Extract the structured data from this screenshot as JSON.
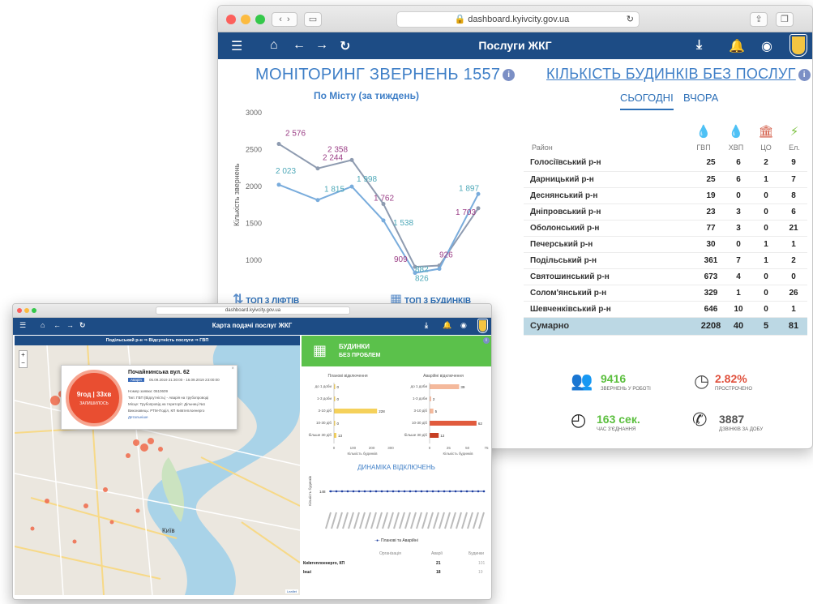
{
  "back": {
    "url": "dashboard.kyivcity.gov.ua",
    "app_title": "Послуги ЖКГ",
    "monitoring": {
      "title": "МОНІТОРИНГ ЗВЕРНЕНЬ 1557",
      "subtitle": "По Місту (за тиждень)",
      "ylabel": "Кількість звернень",
      "yticks": [
        "3000",
        "2500",
        "2000",
        "1500",
        "1000"
      ]
    },
    "buildings": {
      "title": "КІЛЬКІСТЬ БУДИНКІВ БЕЗ ПОСЛУГ",
      "tab_today": "СЬОГОДНІ",
      "tab_yesterday": "ВЧОРА",
      "col_district": "Район",
      "cols": [
        "ГВП",
        "ХВП",
        "ЦО",
        "Ел."
      ],
      "rows": [
        {
          "name": "Голосіївський р-н",
          "v": [
            "25",
            "6",
            "2",
            "9"
          ]
        },
        {
          "name": "Дарницький р-н",
          "v": [
            "25",
            "6",
            "1",
            "7"
          ]
        },
        {
          "name": "Деснянський р-н",
          "v": [
            "19",
            "0",
            "0",
            "8"
          ]
        },
        {
          "name": "Дніпровський р-н",
          "v": [
            "23",
            "3",
            "0",
            "6"
          ]
        },
        {
          "name": "Оболонський р-н",
          "v": [
            "77",
            "3",
            "0",
            "21"
          ]
        },
        {
          "name": "Печерський р-н",
          "v": [
            "30",
            "0",
            "1",
            "1"
          ]
        },
        {
          "name": "Подільський р-н",
          "v": [
            "361",
            "7",
            "1",
            "2"
          ]
        },
        {
          "name": "Святошинський р-н",
          "v": [
            "673",
            "4",
            "0",
            "0"
          ]
        },
        {
          "name": "Солом'янський р-н",
          "v": [
            "329",
            "1",
            "0",
            "26"
          ]
        },
        {
          "name": "Шевченківський р-н",
          "v": [
            "646",
            "10",
            "0",
            "1"
          ]
        }
      ],
      "total": {
        "name": "Сумарно",
        "v": [
          "2208",
          "40",
          "5",
          "81"
        ]
      }
    },
    "top_lifts": "ТОП 3 ЛІФТІВ",
    "top_buildings": "ТОП 3 БУДИНКІВ",
    "stats": {
      "in_work_value": "9416",
      "in_work_label": "ЗВЕРНЕНЬ У РОБОТІ",
      "overdue_value": "2.82%",
      "overdue_label": "ПРОСТРОЧЕНО",
      "connect_value": "163 сек.",
      "connect_label": "ЧАС З'ЄДНАННЯ",
      "calls_value": "3887",
      "calls_label": "ДЗВІНКІВ ЗА ДОБУ"
    }
  },
  "front": {
    "url": "dashboard.kyivcity.gov.ua",
    "app_title": "Карта подачі послуг ЖКГ",
    "breadcrumb": "Подільський р-н ⇒ Відсутність послуги ⇒ ГВП",
    "popup": {
      "address": "Почайнинська вул. 62",
      "badge": "Аварія",
      "period": "05.09.2019 21:30:00 - 16.09.2019 23:00:00",
      "order": "Номер заявки: 0610609",
      "type": "Тип: ГВП (Відсутність) - Аварія на трубопроводі",
      "place": "Місце: Трубопровід на території: Дільниці №1",
      "executor": "Виконавець: РТМ-Поділ, КП Київтеплоенерго",
      "details": "Детальніше",
      "timer": "9год | 33хв",
      "timer_label": "ЗАЛИШИЛОСЬ"
    },
    "city_label": "Київ",
    "leaflet": "Leaflet",
    "no_problems": "БУДИНКИ",
    "no_problems2": "БЕЗ ПРОБЛЕМ",
    "planned_title": "Планові відключення",
    "emergency_title": "Аварійні відключення",
    "dyn_title": "ДИНАМІКА ВІДКЛЮЧЕНЬ",
    "dyn_legend": "Планові та Аварійні",
    "dyn_value": "148",
    "x_caption": "Кількість будинків",
    "y_caption": "Кількість будинків",
    "table_head": [
      "Організація",
      "Аварії",
      "Будинки"
    ],
    "table_rows": [
      {
        "org": "Київтеплоенерго, КП",
        "a": "21",
        "b": "101"
      },
      {
        "org": "Інші",
        "a": "18",
        "b": "19"
      }
    ]
  },
  "chart_data": [
    {
      "type": "line",
      "title": "МОНІТОРИНГ ЗВЕРНЕНЬ 1557",
      "subtitle": "По Місту (за тиждень)",
      "ylabel": "Кількість звернень",
      "ylim": [
        800,
        3000
      ],
      "x": [
        1,
        2,
        3,
        4,
        5,
        6,
        7,
        8,
        9,
        10,
        11
      ],
      "series": [
        {
          "name": "",
          "color": "#8e9bb0",
          "values": [
            2576,
            2244,
            2358,
            1762,
            909,
            926,
            1703
          ]
        },
        {
          "name": "",
          "color": "#79acdc",
          "values": [
            2023,
            1815,
            1998,
            1538,
            826,
            882,
            1897
          ]
        }
      ],
      "labels_a": [
        "2 576",
        "2 244",
        "2 358",
        "1 762",
        "909",
        "926",
        "1 703"
      ],
      "labels_b": [
        "2 023",
        "1 815",
        "1 998",
        "1 538",
        "826",
        "882",
        "1 897"
      ]
    },
    {
      "type": "bar",
      "title": "Планові відключення",
      "categories": [
        "до 1 доби",
        "1-3 доби",
        "3-10 діб",
        "10-30 діб",
        "більше 30 діб"
      ],
      "values": [
        0,
        0,
        228,
        0,
        13
      ],
      "xlim": [
        0,
        300
      ]
    },
    {
      "type": "bar",
      "title": "Аварійні відключення",
      "categories": [
        "до 1 доби",
        "1-3 доби",
        "3-10 діб",
        "10-30 діб",
        "більше 30 діб"
      ],
      "values": [
        39,
        2,
        5,
        62,
        12
      ],
      "xlim": [
        0,
        75
      ]
    }
  ]
}
